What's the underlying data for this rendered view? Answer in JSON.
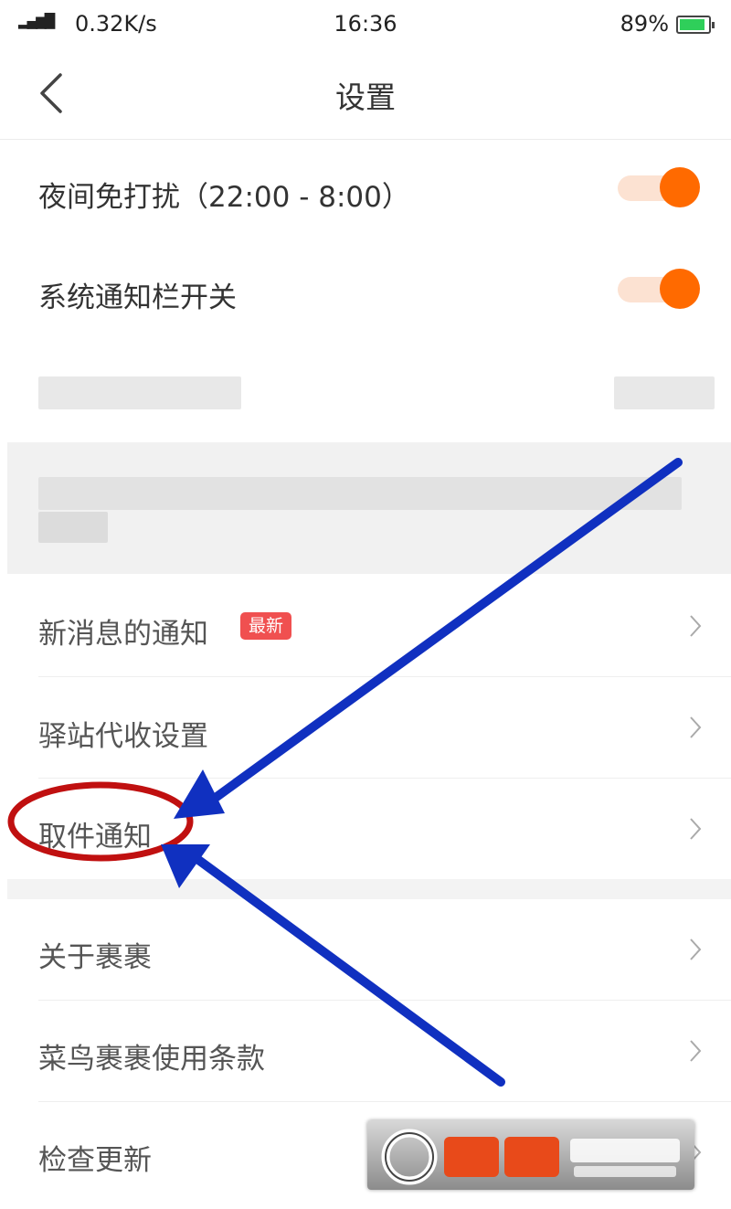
{
  "status_bar": {
    "network_speed": "0.32K/s",
    "time": "16:36",
    "battery": "89%",
    "battery_level": 0.89
  },
  "nav": {
    "title": "设置"
  },
  "settings": {
    "dnd_label": "夜间免打扰（22:00 - 8:00）",
    "dnd_on": true,
    "system_notify_label": "系统通知栏开关",
    "system_notify_on": true,
    "new_message_label": "新消息的通知",
    "new_badge": "最新",
    "station_label": "驿站代收设置",
    "pickup_label": "取件通知",
    "about_label": "关于裹裹",
    "terms_label": "菜鸟裹裹使用条款",
    "update_label": "检查更新"
  },
  "colors": {
    "accent": "#ff6a00",
    "badge": "#f05050",
    "annotation_arrow": "#1030c0",
    "annotation_circle": "#c01010"
  }
}
